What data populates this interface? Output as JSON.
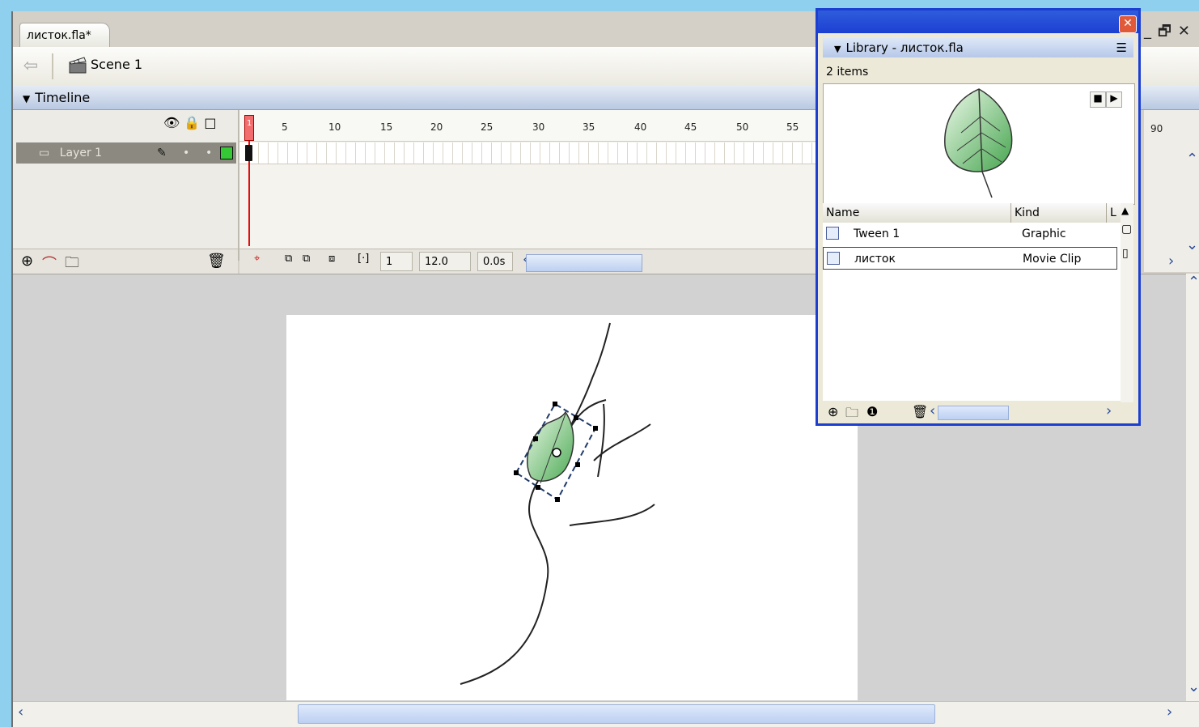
{
  "document": {
    "tab_label": "листок.fla*",
    "scene_label": "Scene 1"
  },
  "timeline": {
    "header_label": "Timeline",
    "layer_name": "Layer 1",
    "ruler_ticks": [
      "1",
      "5",
      "10",
      "15",
      "20",
      "25",
      "30",
      "35",
      "40",
      "45",
      "50",
      "55",
      "90"
    ],
    "status": {
      "current_frame": "1",
      "frame_rate": "12.0 fps",
      "elapsed_time": "0.0s"
    }
  },
  "library": {
    "title": "Library - листок.fla",
    "item_count": "2 items",
    "columns": {
      "name": "Name",
      "kind": "Kind",
      "linkage": "L"
    },
    "items": [
      {
        "name": "Tween 1",
        "kind": "Graphic"
      },
      {
        "name": "листок",
        "kind": "Movie Clip"
      }
    ]
  },
  "colors": {
    "background": "#8fd0ee",
    "panel_border": "#1c3fd2",
    "playhead": "#e01010",
    "leaf_green": "#5fb85f"
  }
}
